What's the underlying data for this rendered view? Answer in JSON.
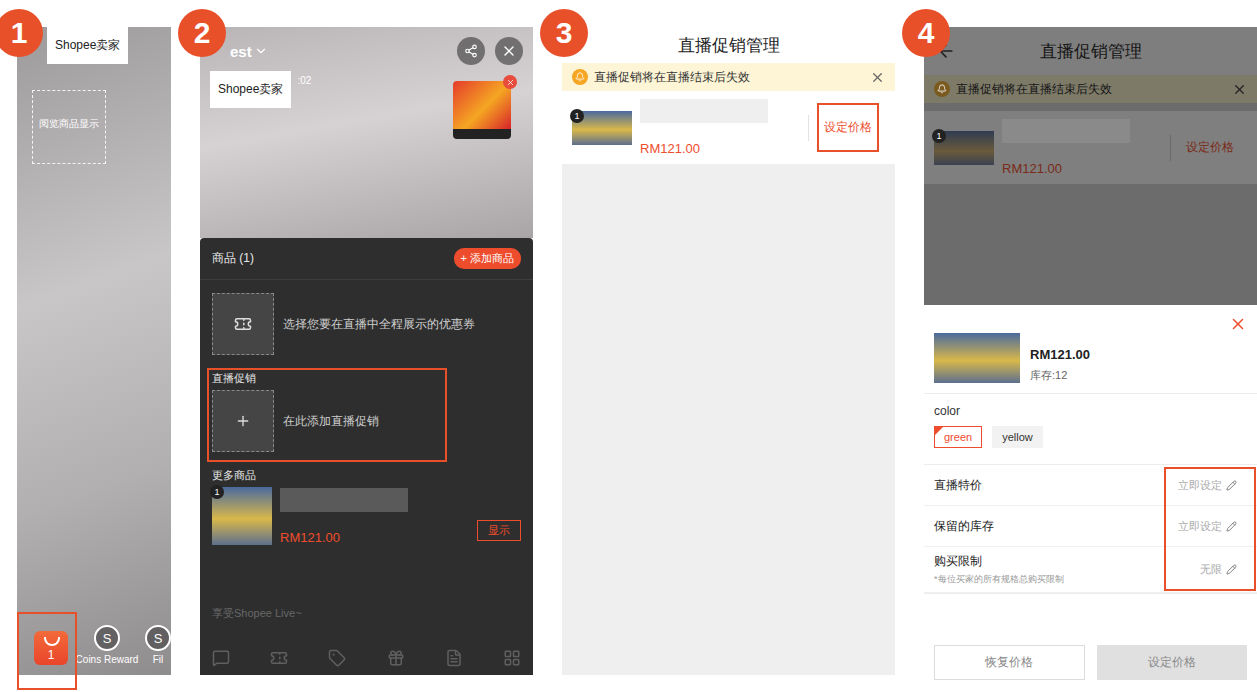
{
  "steps": [
    "1",
    "2",
    "3",
    "4"
  ],
  "setup": {
    "brand": "Shopee卖家",
    "preview_box": "阅览商品显示",
    "cart": {
      "count": "1",
      "highlighted": true
    },
    "tools": [
      {
        "label": "Coins Reward",
        "icon": "S"
      },
      {
        "label": "Fil",
        "icon": "S"
      }
    ]
  },
  "live_room": {
    "title": "est",
    "brand": "Shopee卖家",
    "timer": ":02",
    "products_panel": {
      "title": "商品 (1)",
      "add_button": "+ 添加商品",
      "coupon_hint": "选择您要在直播中全程展示的优惠券",
      "promo_label": "直播促销",
      "promo_add": {
        "text": "在此添加直播促销",
        "highlighted": true
      },
      "more_label": "更多商品",
      "items": [
        {
          "index": "1",
          "price": "RM121.00",
          "action": "显示"
        }
      ]
    },
    "footer_hint": "享受Shopee Live~"
  },
  "promo_manager": {
    "title": "直播促销管理",
    "notice": "直播促销将在直播结束后失效",
    "items": [
      {
        "index": "1",
        "price": "RM121.00",
        "action": "设定价格",
        "highlighted": true
      }
    ]
  },
  "price_sheet": {
    "title": "直播促销管理",
    "notice": "直播促销将在直播结束后失效",
    "item": {
      "index": "1",
      "price": "RM121.00",
      "action": "设定价格",
      "highlighted": false
    },
    "product": {
      "price": "RM121.00",
      "stock": "库存:12"
    },
    "option_group": {
      "label": "color",
      "options": [
        {
          "label": "green",
          "selected": true
        },
        {
          "label": "yellow",
          "selected": false
        }
      ]
    },
    "fields_highlighted": true,
    "fields": [
      {
        "label": "直播特价",
        "value": "立即设定",
        "hint": ""
      },
      {
        "label": "保留的库存",
        "value": "立即设定",
        "hint": ""
      },
      {
        "label": "购买限制",
        "value": "无限",
        "hint": "*每位买家的所有规格总购买限制"
      }
    ],
    "buttons": [
      {
        "label": "恢复价格",
        "kind": "outline"
      },
      {
        "label": "设定价格",
        "kind": "disabled"
      }
    ]
  }
}
